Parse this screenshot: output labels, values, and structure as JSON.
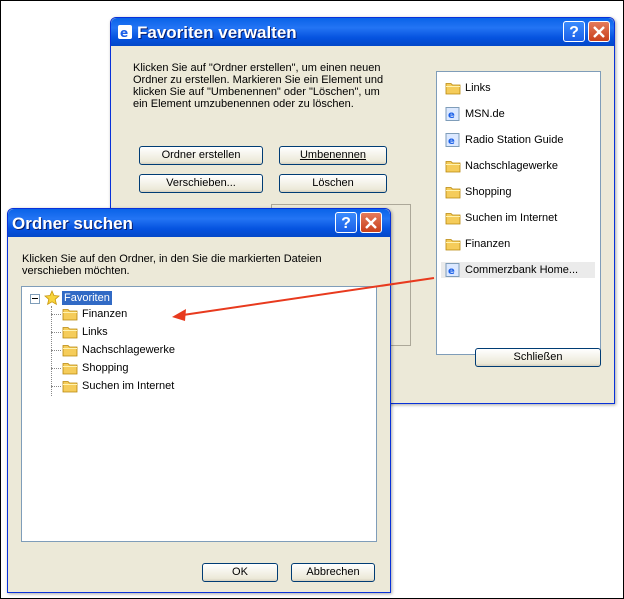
{
  "manage_dialog": {
    "title": "Favoriten verwalten",
    "description": "Klicken Sie auf \"Ordner erstellen\", um einen neuen Ordner zu erstellen. Markieren Sie ein Element und klicken Sie auf \"Umbenennen\" oder \"Löschen\", um ein Element umzubenennen oder zu löschen.",
    "buttons": {
      "create_folder": "Ordner erstellen",
      "rename": "Umbenennen",
      "move": "Verschieben...",
      "delete": "Löschen",
      "close": "Schließen"
    },
    "items": [
      {
        "label": "Links",
        "icon": "folder-icon"
      },
      {
        "label": "MSN.de",
        "icon": "ie-link-icon"
      },
      {
        "label": "Radio Station Guide",
        "icon": "ie-link-icon"
      },
      {
        "label": "Nachschlagewerke",
        "icon": "folder-icon"
      },
      {
        "label": "Shopping",
        "icon": "folder-icon"
      },
      {
        "label": "Suchen im Internet",
        "icon": "folder-icon"
      },
      {
        "label": "Finanzen",
        "icon": "folder-icon"
      },
      {
        "label": "Commerzbank Home...",
        "icon": "ie-link-icon"
      }
    ],
    "selected_item": "Commerzbank Home..."
  },
  "find_dialog": {
    "title": "Ordner suchen",
    "description": "Klicken Sie auf den Ordner, in den Sie die markierten Dateien verschieben möchten.",
    "tree": {
      "root": "Favoriten",
      "children": [
        "Finanzen",
        "Links",
        "Nachschlagewerke",
        "Shopping",
        "Suchen im Internet"
      ]
    },
    "ok_label": "OK",
    "cancel_label": "Abbrechen"
  },
  "colors": {
    "titlebar_blue": "#0553e0",
    "annotation_arrow": "#e83a1e",
    "selection": "#316ac5"
  }
}
